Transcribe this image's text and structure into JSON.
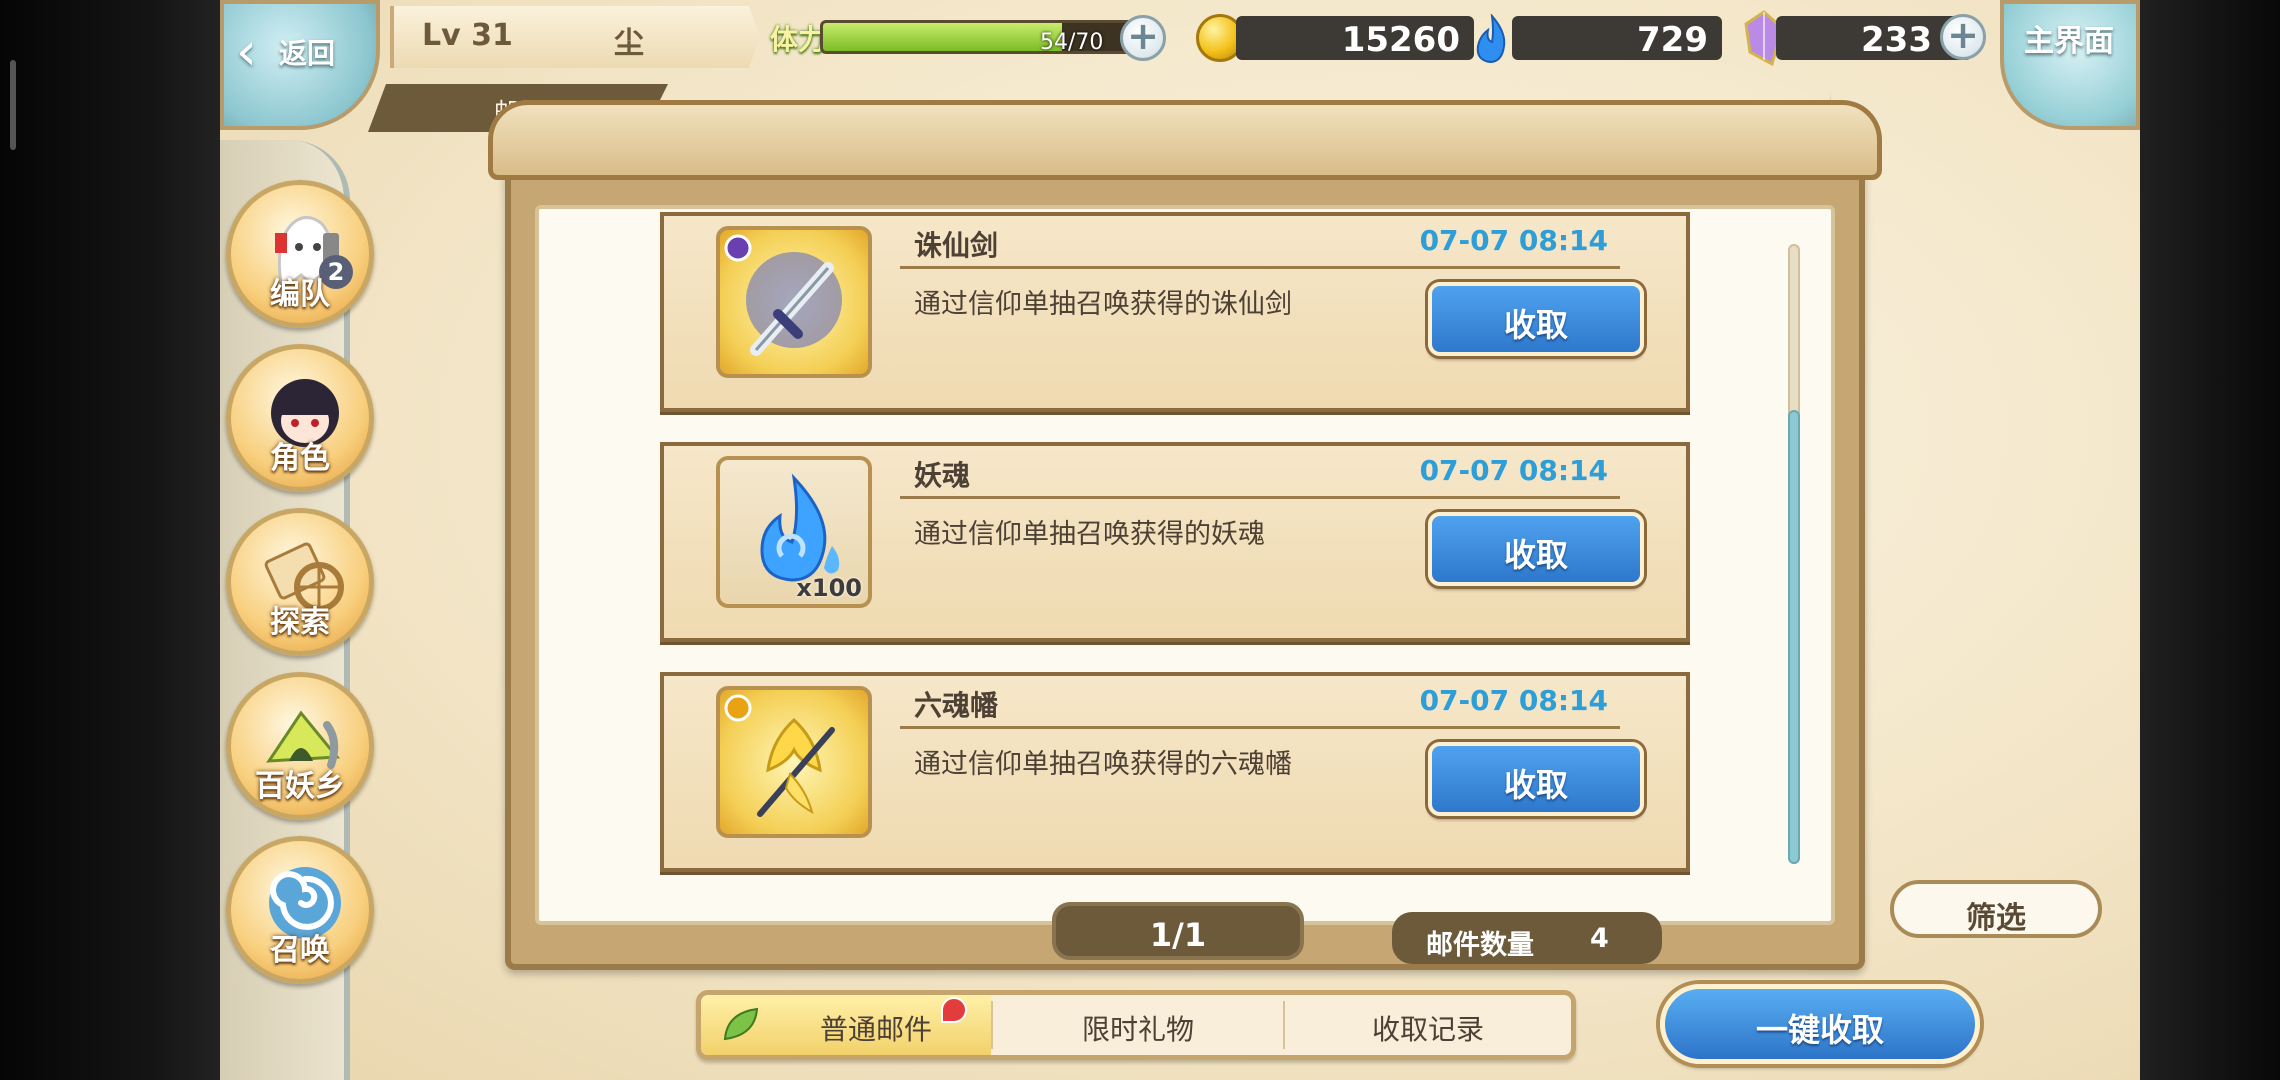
{
  "header": {
    "back_label": "返回",
    "level": "Lv 31",
    "player_name": "尘",
    "page_title": "邮件",
    "home_label": "主界面"
  },
  "resources": {
    "stamina_label": "体力",
    "stamina_text": "54/70",
    "stamina_fraction": 0.77,
    "gold": "15260",
    "soul": "729",
    "crystal": "233"
  },
  "sidebar": {
    "items": [
      {
        "label": "编队",
        "badge": "2"
      },
      {
        "label": "角色"
      },
      {
        "label": "探索"
      },
      {
        "label": "百妖乡"
      },
      {
        "label": "召唤"
      }
    ]
  },
  "mails": [
    {
      "title": "诛仙剑",
      "time": "07-07 08:14",
      "desc": "通过信仰单抽召唤获得的诛仙剑",
      "button": "收取",
      "icon": "sword-icon",
      "count": ""
    },
    {
      "title": "妖魂",
      "time": "07-07 08:14",
      "desc": "通过信仰单抽召唤获得的妖魂",
      "button": "收取",
      "icon": "blue-flame-icon",
      "count": "x100"
    },
    {
      "title": "六魂幡",
      "time": "07-07 08:14",
      "desc": "通过信仰单抽召唤获得的六魂幡",
      "button": "收取",
      "icon": "banner-icon",
      "count": ""
    }
  ],
  "pagination": {
    "page": "1/1"
  },
  "mail_count": {
    "label": "邮件数量",
    "value": "4"
  },
  "filter_label": "筛选",
  "tabs": [
    {
      "label": "普通邮件",
      "active": true
    },
    {
      "label": "限时礼物"
    },
    {
      "label": "收取记录"
    }
  ],
  "claim_all_label": "一键收取",
  "colors": {
    "accent_blue": "#2e78cc",
    "time_blue": "#2d9ed8",
    "wood_brown": "#6d5a3b"
  }
}
